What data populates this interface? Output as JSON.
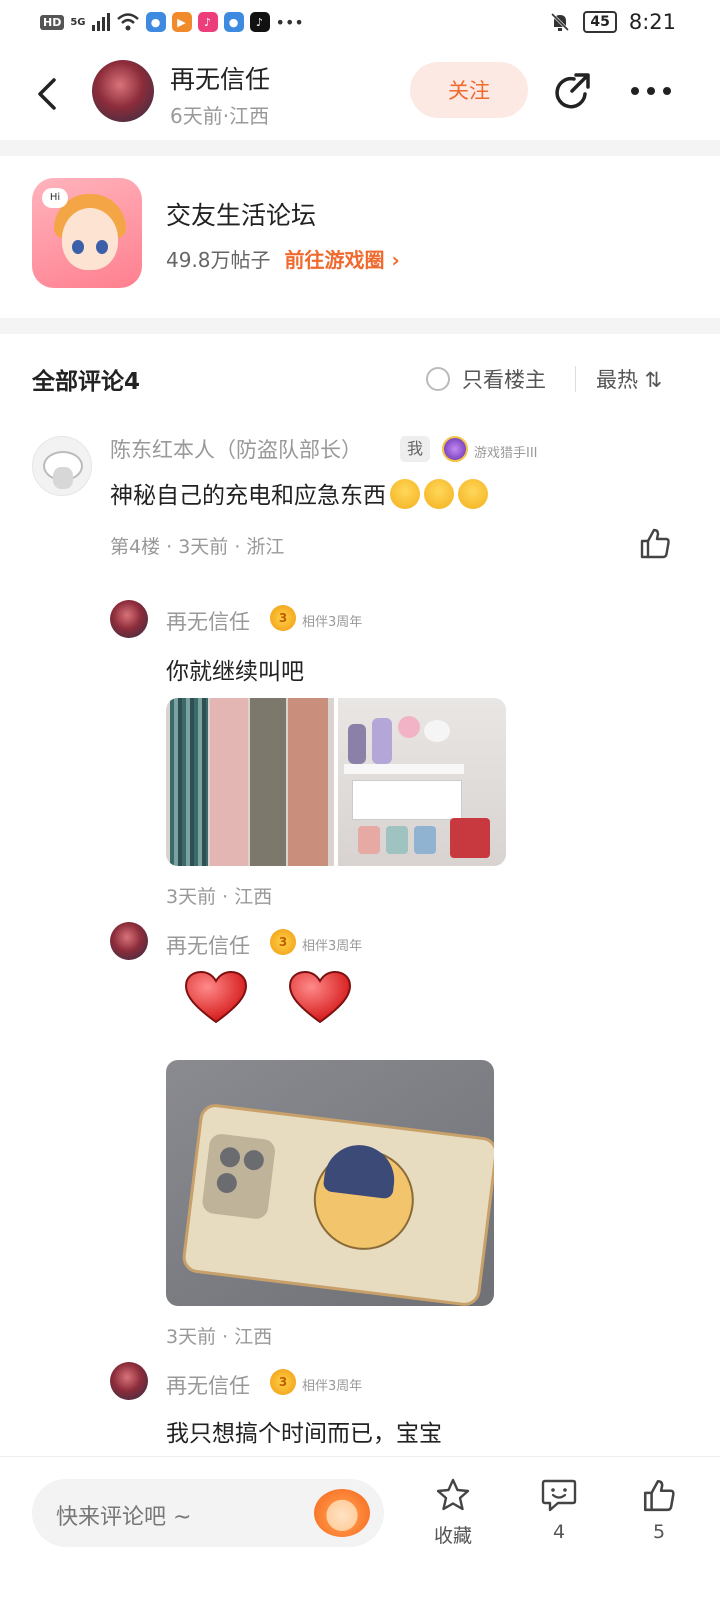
{
  "status_bar": {
    "network_badge": "HD",
    "signal_label": "5G",
    "battery": "45",
    "time": "8:21"
  },
  "header": {
    "author_name": "再无信任",
    "author_meta": "6天前·江西",
    "follow_label": "关注"
  },
  "forum": {
    "icon_text": "Hi",
    "title": "交友生活论坛",
    "post_count": "49.8万帖子",
    "link_label": "前往游戏圈 ›"
  },
  "comments_header": {
    "title": "全部评论4",
    "only_op_label": "只看楼主",
    "sort_label": "最热 ⇅"
  },
  "comment": {
    "user": "陈东红本人（防盗队部长）",
    "me_tag": "我",
    "badge": "游戏猎手III",
    "text": "神秘自己的充电和应急东西",
    "meta": "第4楼 · 3天前 · 浙江"
  },
  "replies": [
    {
      "user": "再无信任",
      "anniversary_number": "3",
      "anniversary_label": "相伴3周年",
      "text": "你就继续叫吧",
      "meta": "3天前 · 江西"
    },
    {
      "user": "再无信任",
      "anniversary_number": "3",
      "anniversary_label": "相伴3周年",
      "text": "",
      "meta": "3天前 · 江西"
    },
    {
      "user": "再无信任",
      "anniversary_number": "3",
      "anniversary_label": "相伴3周年",
      "text": "我只想搞个时间而已，宝宝"
    }
  ],
  "bottom_bar": {
    "input_placeholder": "快来评论吧 ~",
    "favorite_label": "收藏",
    "comment_count": "4",
    "like_count": "5"
  },
  "colors": {
    "accent": "#f06a2e",
    "follow_bg": "#fde9e3",
    "muted_text": "#999999"
  }
}
